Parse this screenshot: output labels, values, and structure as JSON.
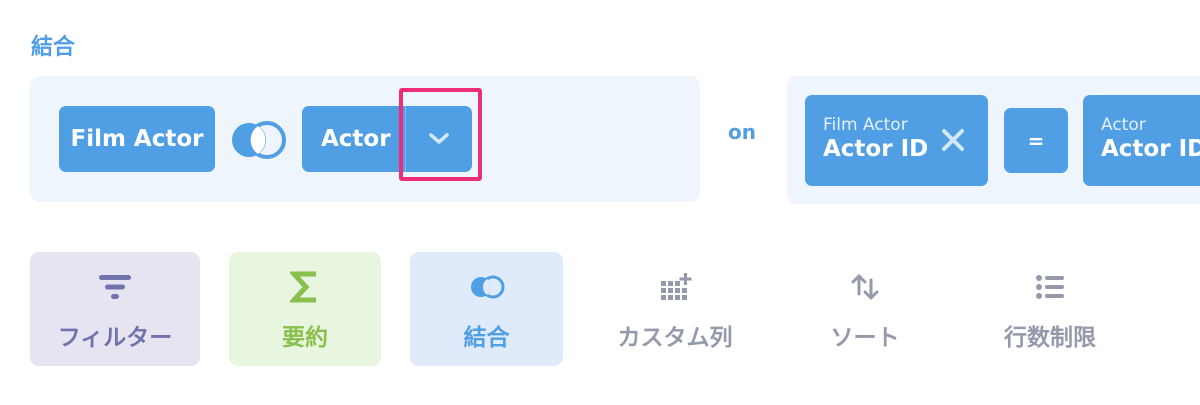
{
  "section": {
    "title": "結合"
  },
  "join": {
    "left_table": "Film Actor",
    "right_table": "Actor",
    "on_label": "on",
    "condition": {
      "left": {
        "table": "Film Actor",
        "column": "Actor ID"
      },
      "operator": "=",
      "right": {
        "table": "Actor",
        "column": "Actor ID"
      }
    }
  },
  "actions": [
    {
      "label": "フィルター",
      "icon": "filter-icon",
      "color": "#7173ad"
    },
    {
      "label": "要約",
      "icon": "sigma-icon",
      "color": "#88bf4d"
    },
    {
      "label": "結合",
      "icon": "join-icon",
      "color": "#509ee3"
    },
    {
      "label": "カスタム列",
      "icon": "custom-column-icon",
      "color": "#949aab"
    },
    {
      "label": "ソート",
      "icon": "sort-icon",
      "color": "#949aab"
    },
    {
      "label": "行数制限",
      "icon": "list-icon",
      "color": "#949aab"
    }
  ],
  "colors": {
    "accent": "#509ee3",
    "highlight": "#ec2e78",
    "panel_bg": "#eef5fd"
  }
}
